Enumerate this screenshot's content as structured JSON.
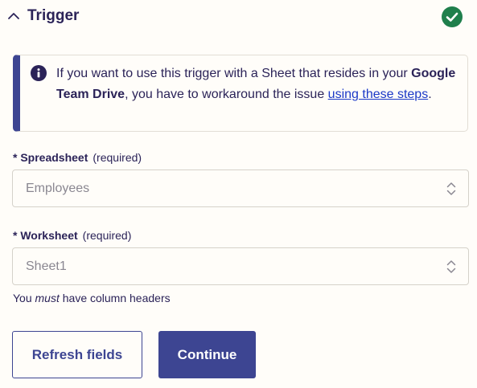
{
  "header": {
    "title": "Trigger",
    "collapse_icon": "chevron-up-icon",
    "status_icon": "check-circle-icon",
    "status_color": "#1f7f4c"
  },
  "alert": {
    "icon": "info-icon",
    "text_before": "If you want to use this trigger with a Sheet that resides in your ",
    "bold_text": "Google Team Drive",
    "text_middle": ", you have to workaround the issue ",
    "link_text": "using these steps",
    "text_after": ".",
    "accent_color": "#3d4592"
  },
  "fields": {
    "spreadsheet": {
      "asterisk": "*",
      "label": "Spreadsheet",
      "note": "(required)",
      "value": "Employees"
    },
    "worksheet": {
      "asterisk": "*",
      "label": "Worksheet",
      "note": "(required)",
      "value": "Sheet1"
    }
  },
  "helper": {
    "before": "You ",
    "emphasis": "must",
    "after": " have column headers"
  },
  "buttons": {
    "refresh_label": "Refresh fields",
    "continue_label": "Continue"
  }
}
